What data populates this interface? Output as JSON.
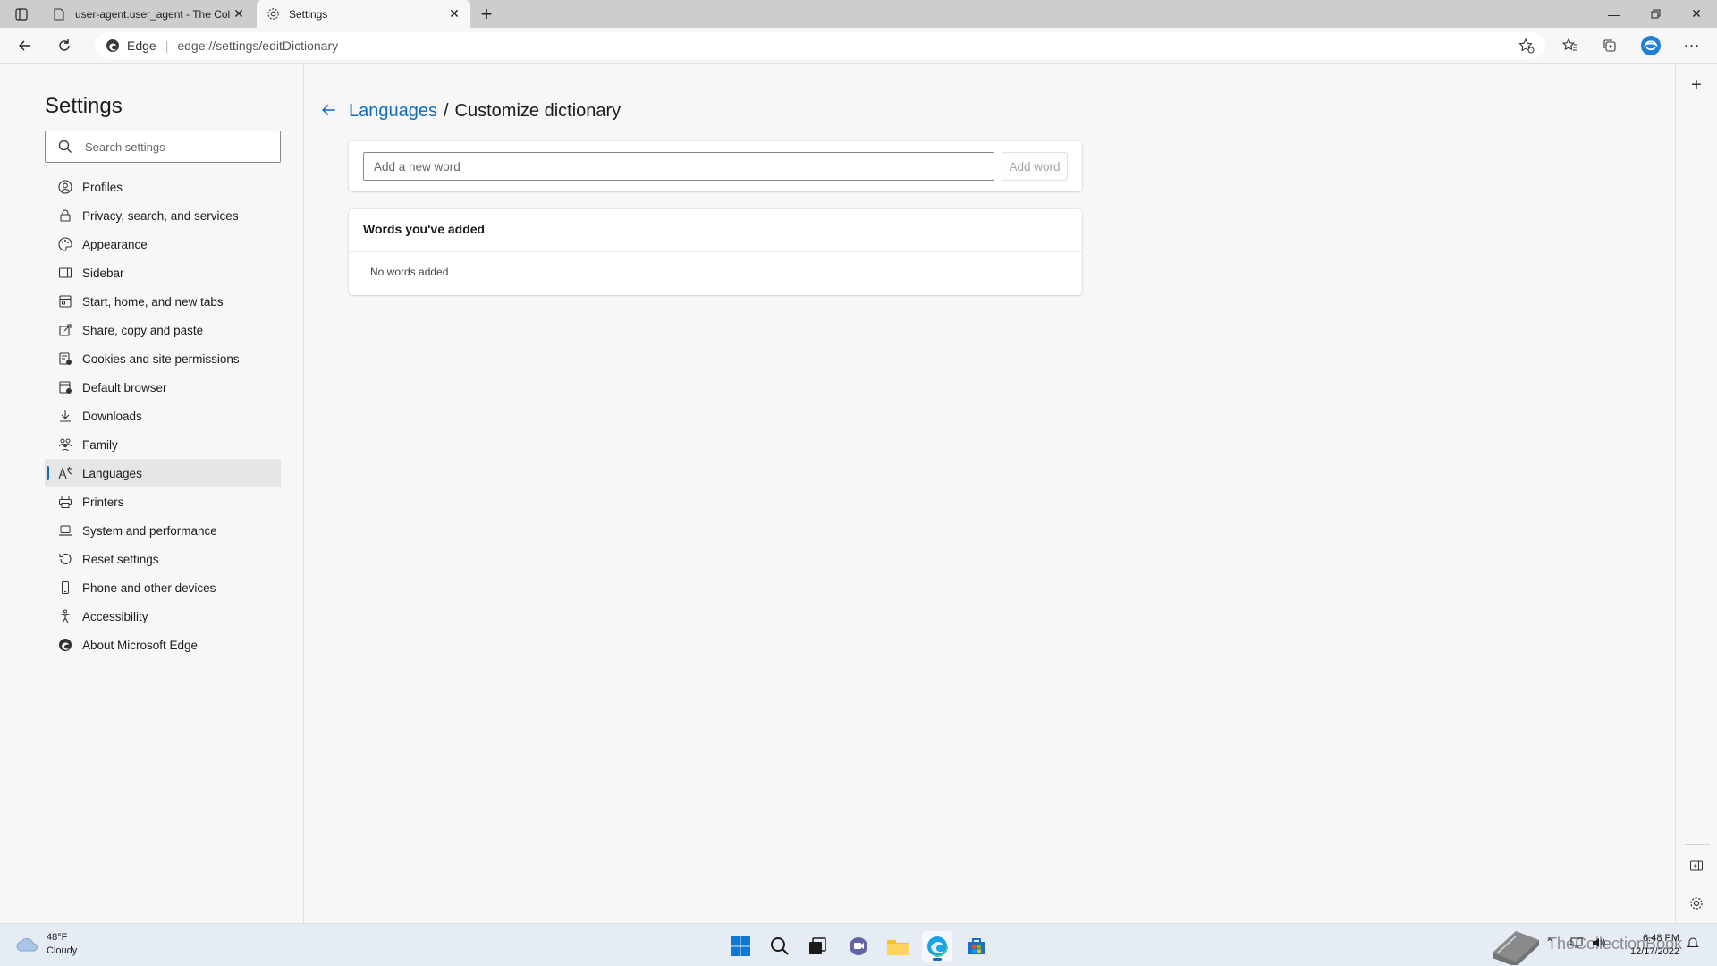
{
  "tabs": [
    {
      "title": "user-agent.user_agent - The Coll",
      "icon": "page-icon"
    },
    {
      "title": "Settings",
      "icon": "gear-icon",
      "active": true
    }
  ],
  "address_bar": {
    "site_label": "Edge",
    "url": "edge://settings/editDictionary"
  },
  "sidebar": {
    "title": "Settings",
    "search_placeholder": "Search settings",
    "items": [
      {
        "label": "Profiles",
        "icon": "profile-icon"
      },
      {
        "label": "Privacy, search, and services",
        "icon": "lock-icon"
      },
      {
        "label": "Appearance",
        "icon": "appearance-icon"
      },
      {
        "label": "Sidebar",
        "icon": "sidebar-icon"
      },
      {
        "label": "Start, home, and new tabs",
        "icon": "home-icon"
      },
      {
        "label": "Share, copy and paste",
        "icon": "share-icon"
      },
      {
        "label": "Cookies and site permissions",
        "icon": "cookies-icon"
      },
      {
        "label": "Default browser",
        "icon": "browser-icon"
      },
      {
        "label": "Downloads",
        "icon": "download-icon"
      },
      {
        "label": "Family",
        "icon": "family-icon"
      },
      {
        "label": "Languages",
        "icon": "languages-icon",
        "active": true
      },
      {
        "label": "Printers",
        "icon": "printer-icon"
      },
      {
        "label": "System and performance",
        "icon": "laptop-icon"
      },
      {
        "label": "Reset settings",
        "icon": "reset-icon"
      },
      {
        "label": "Phone and other devices",
        "icon": "phone-icon"
      },
      {
        "label": "Accessibility",
        "icon": "accessibility-icon"
      },
      {
        "label": "About Microsoft Edge",
        "icon": "edge-icon"
      }
    ]
  },
  "main": {
    "breadcrumb_parent": "Languages",
    "breadcrumb_separator": "/",
    "breadcrumb_current": "Customize dictionary",
    "add_word_placeholder": "Add a new word",
    "add_word_button": "Add word",
    "words_header": "Words you've added",
    "words_empty": "No words added"
  },
  "taskbar": {
    "weather_temp": "48°F",
    "weather_desc": "Cloudy",
    "watermark": "TheCollectionBook",
    "time": "6:48 PM",
    "date": "12/17/2022"
  },
  "colors": {
    "accent": "#0f6cbd",
    "background": "#f7f7f7",
    "tabstrip": "#cdcdcd"
  }
}
